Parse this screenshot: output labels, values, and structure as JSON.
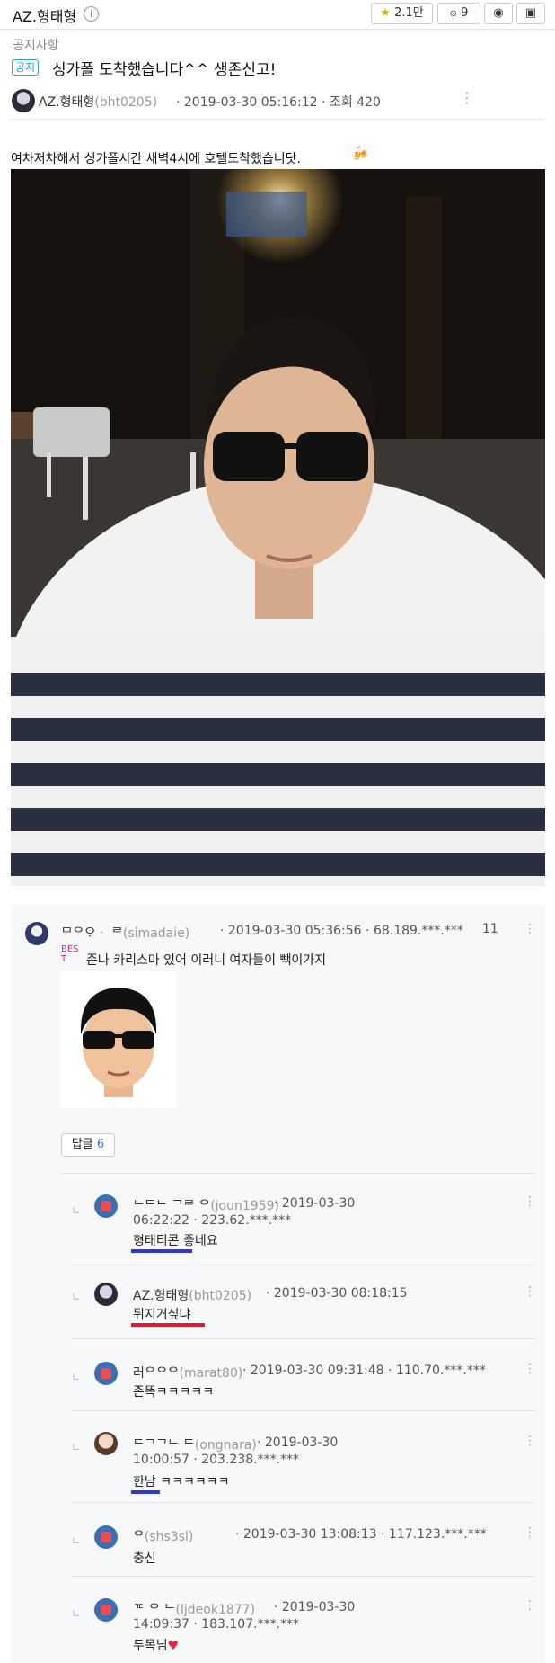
{
  "header": {
    "channel": "AZ.형태형",
    "info_icon": "i",
    "stats": [
      {
        "icon": "star-icon",
        "value": "2.1만"
      },
      {
        "icon": "users-icon",
        "value": "9"
      }
    ]
  },
  "post": {
    "category": "공지사항",
    "badge": "공지",
    "title": "싱가폴 도착했습니다^^ 생존신고!",
    "author_name": "AZ.형태형",
    "author_id": "(bht0205)",
    "datetime": "· 2019-03-30 05:16:12 · 조회 420",
    "body": "여차저차해서 싱가폴시간 새벽4시에 호텔도착했습니닷.",
    "beer_icon": "🍻"
  },
  "comment": {
    "name": "ᄆᄋᄋᆞᆞ ᄅ",
    "id": "(simadaie)",
    "meta": "· 2019-03-30 05:36:56 · 68.189.***.***",
    "count": "11",
    "best_badge": "BEST",
    "text": "존나 카리스마 있어 이러니 여자들이 빽이가지",
    "reply_button_label": "답글",
    "reply_count": "6"
  },
  "replies": [
    {
      "name": "ᄂᄃᄂ ᄀᄅ ᄋ",
      "id": "(joun1959)",
      "meta_1": "· 2019-03-30",
      "meta_2": "06:22:22 · 223.62.***.***",
      "text": "형태티콘 좋네요",
      "underline": "#2b3bd1"
    },
    {
      "name": "AZ.형태형",
      "id": "(bht0205)",
      "meta_1": "· 2019-03-30 08:18:15",
      "meta_2": "",
      "text": "뒤지거싶냐",
      "underline": "#e21b2c"
    },
    {
      "name": "러ᄋᄋᄋ",
      "id": "(marat80)",
      "meta_1": "· 2019-03-30 09:31:48 · 110.70.***.***",
      "meta_2": "",
      "text": "존똑ㅋㅋㅋㅋㅋ",
      "underline": ""
    },
    {
      "name": "ᄃᄀᄀᄂ ᄃ",
      "id": "(ongnara)",
      "meta_1": "· 2019-03-30",
      "meta_2": "10:00:57 · 203.238.***.***",
      "text": "한남 ㅋㅋㅋㅋㅋㅋ",
      "underline": "#2b3bd1"
    },
    {
      "name": "ᄋ",
      "id": "(shs3sl)",
      "meta_1": "· 2019-03-30 13:08:13 · 117.123.***.***",
      "meta_2": "",
      "text": "충신",
      "underline": ""
    },
    {
      "name": "ᄀᄃ ᄋ ᄂ",
      "id": "(ljdeok1877)",
      "meta_1": "· 2019-03-30",
      "meta_2": "14:09:37 · 183.107.***.***",
      "text": "두목님",
      "underline": ""
    }
  ],
  "colors": {
    "accent": "#2aa4c8",
    "best": "#d8237c",
    "reply_count": "#3a7bd5"
  }
}
